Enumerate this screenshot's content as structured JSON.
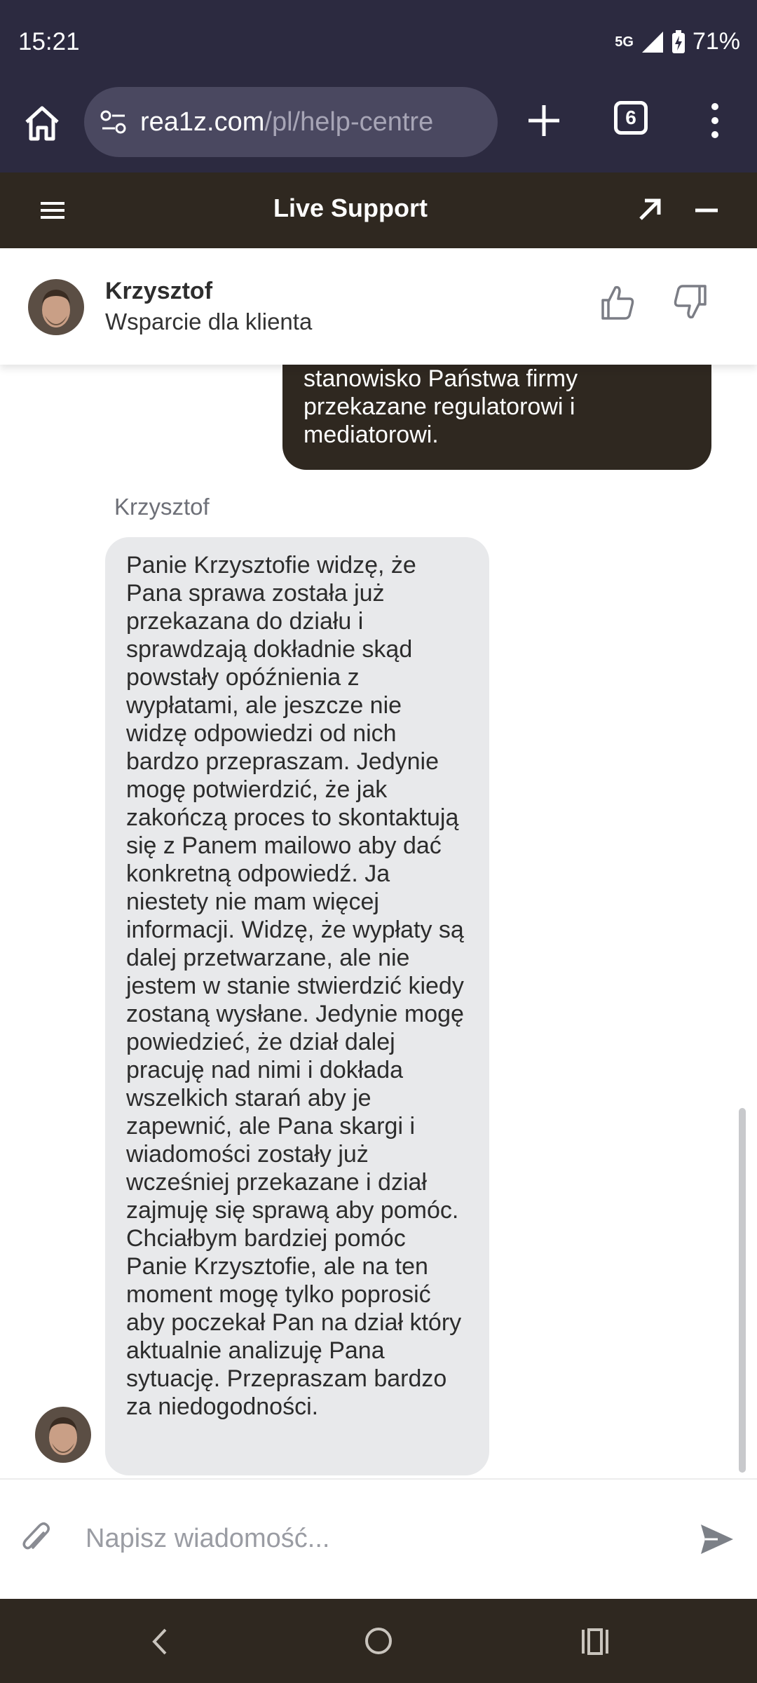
{
  "status_bar": {
    "time": "15:21",
    "network": "5G",
    "battery": "71%"
  },
  "browser": {
    "url_domain": "rea1z.com",
    "url_path": "/pl/help-centre",
    "tab_count": "6"
  },
  "chat_header": {
    "title": "Live Support"
  },
  "agent": {
    "name": "Krzysztof",
    "role": "Wsparcie dla klienta"
  },
  "messages": {
    "user_message_visible": "mojego czasu. Czekam na oficjalne stanowisko Państwa firmy przekazane regulatorowi i mediatorowi.",
    "agent_label": "Krzysztof",
    "agent_message": "Panie Krzysztofie widzę, że Pana sprawa została już przekazana do działu i sprawdzają dokładnie skąd powstały opóźnienia z wypłatami, ale jeszcze nie widzę odpowiedzi od nich bardzo przepraszam. Jedynie mogę potwierdzić, że jak zakończą proces to skontaktują się z Panem mailowo aby dać konkretną odpowiedź. Ja niestety nie mam więcej informacji. Widzę, że wypłaty są dalej przetwarzane, ale nie jestem w stanie stwierdzić kiedy zostaną wysłane. Jedynie mogę powiedzieć, że dział dalej pracuję nad nimi i dokłada wszelkich starań aby je zapewnić, ale Pana skargi i wiadomości zostały już wcześniej przekazane i dział zajmuję się sprawą aby pomóc. Chciałbym bardziej pomóc Panie Krzysztofie, ale na ten moment mogę tylko poprosić aby poczekał Pan na dział który aktualnie analizuję Pana sytuację. Przepraszam bardzo za niedogodności."
  },
  "composer": {
    "placeholder": "Napisz wiadomość..."
  },
  "colors": {
    "status_bg": "#2c2a40",
    "header_bg": "#2f2820",
    "agent_bubble": "#e8e9eb",
    "user_bubble": "#2f2820"
  }
}
